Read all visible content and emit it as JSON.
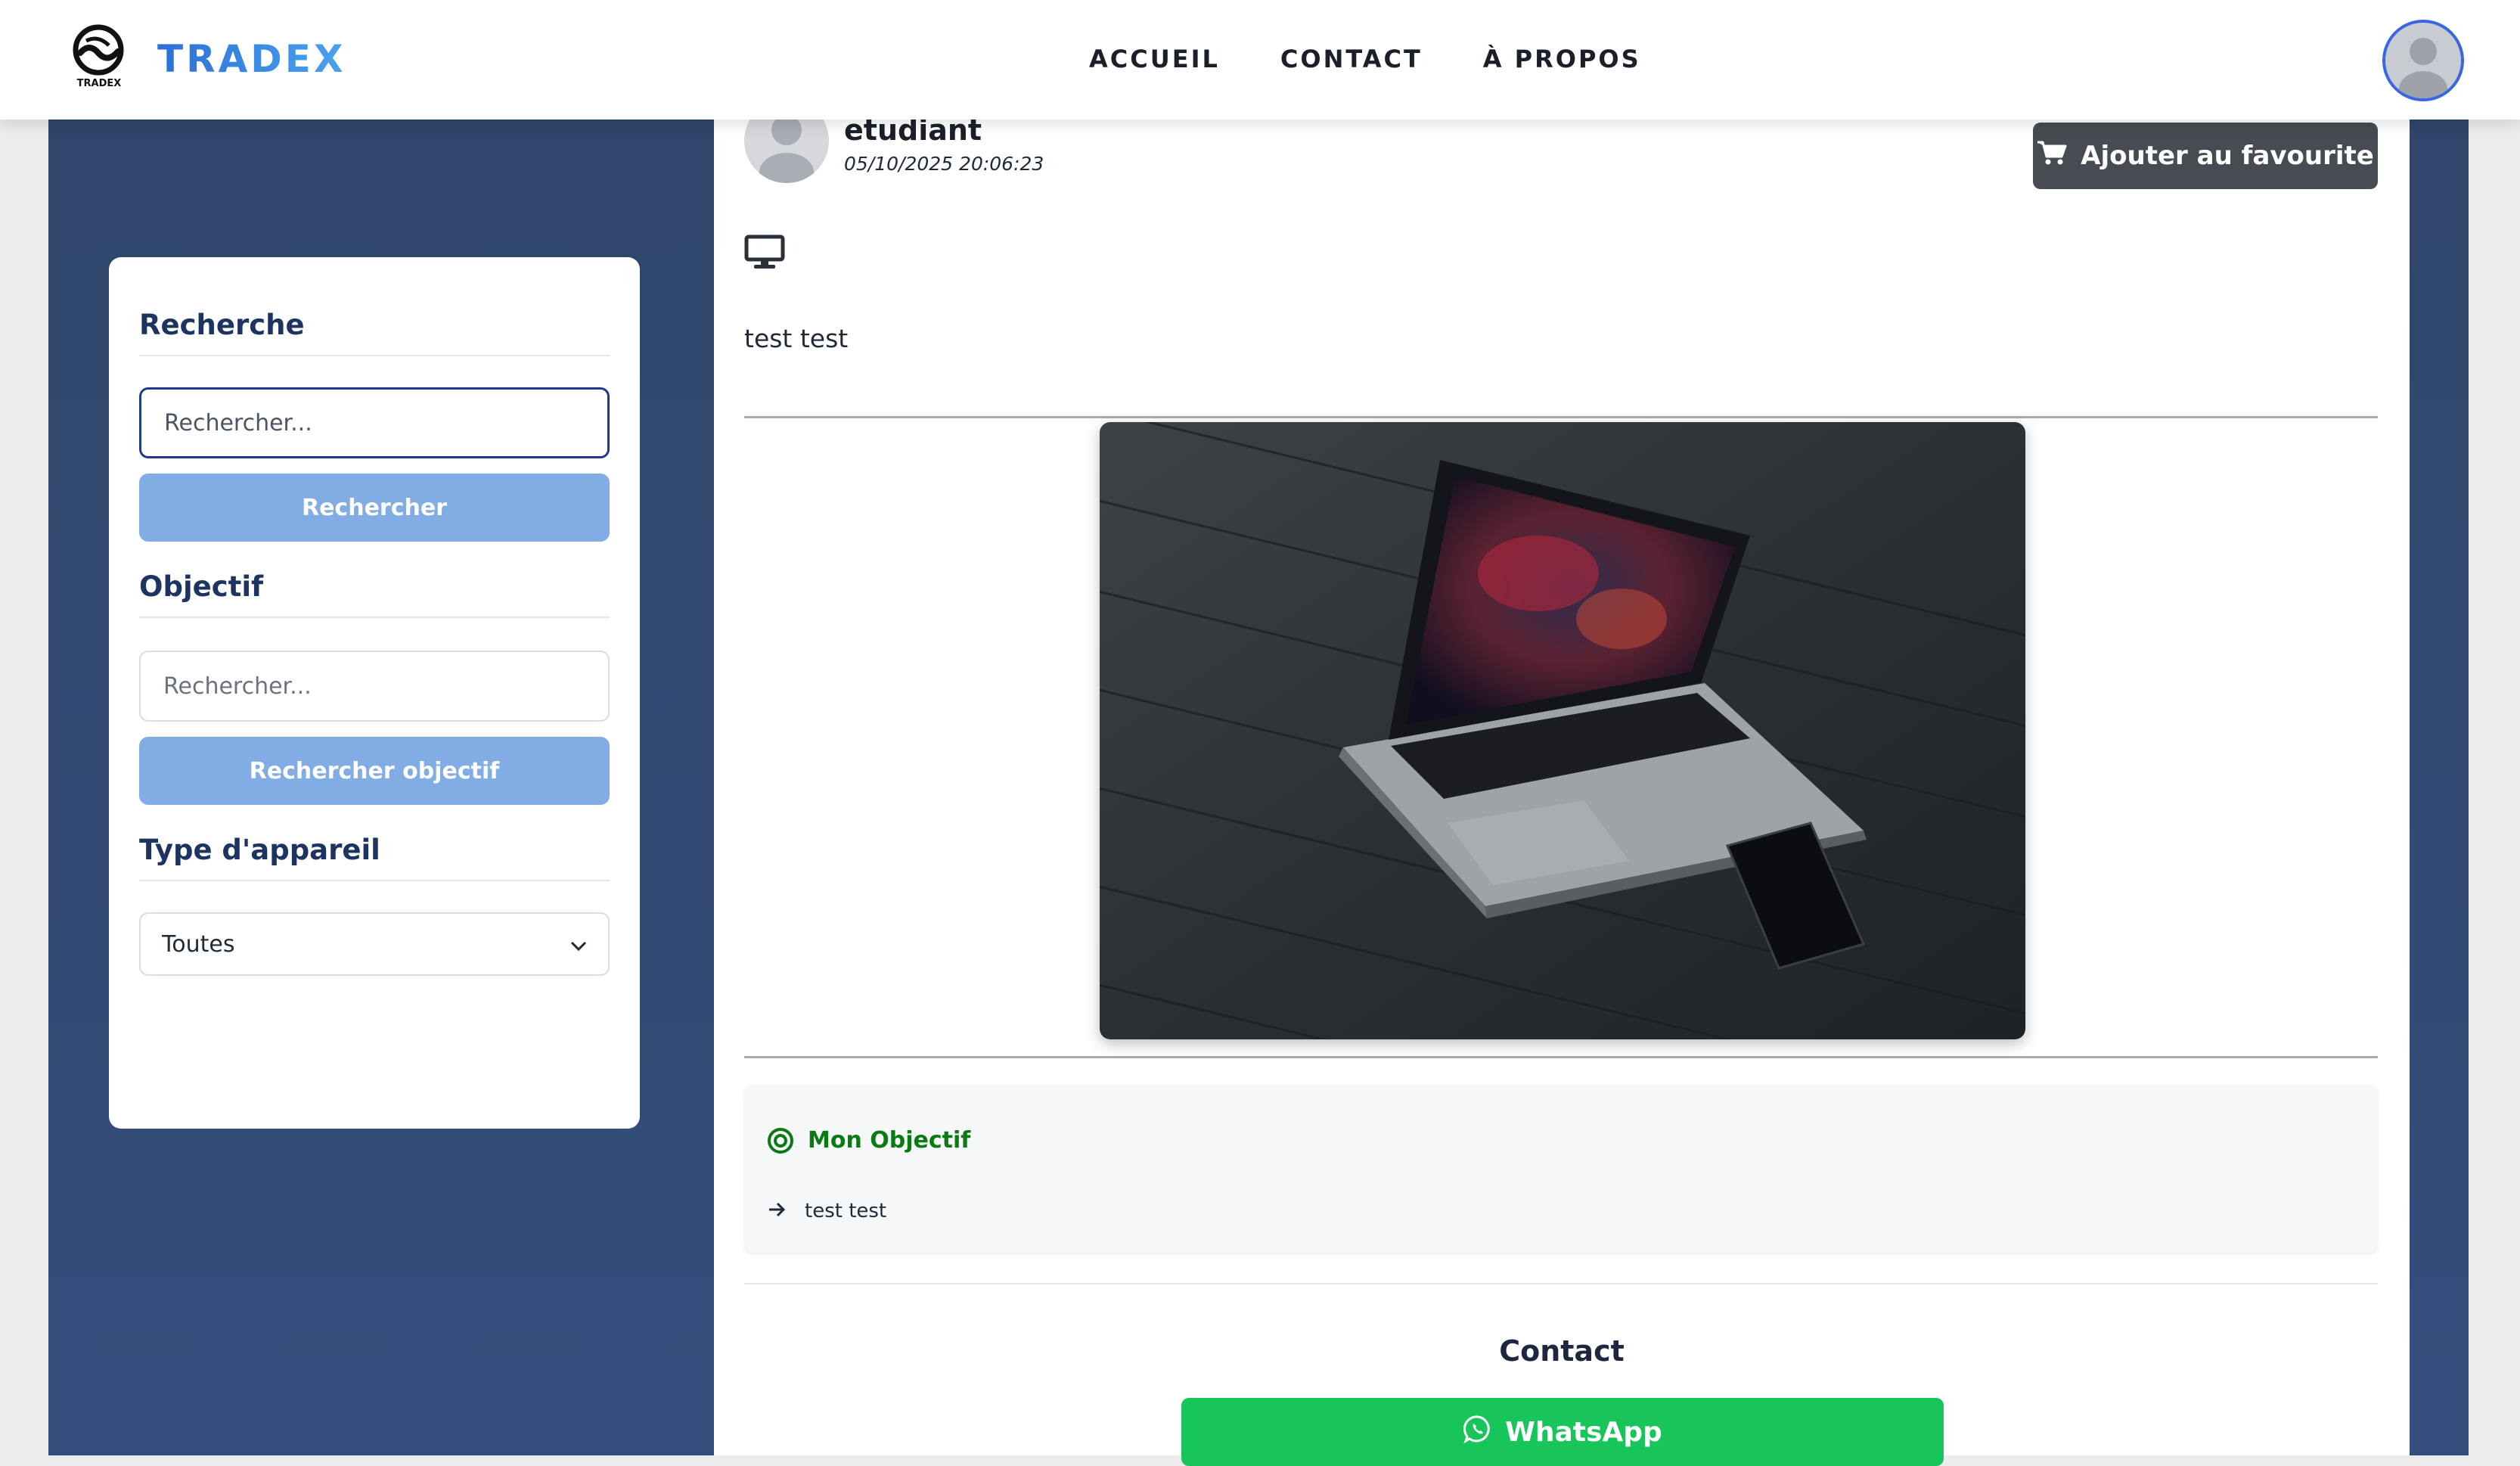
{
  "brand": {
    "name": "TRADEX",
    "logo_caption": "TRADEX"
  },
  "nav": {
    "items": [
      "ACCUEIL",
      "CONTACT",
      "À PROPOS"
    ]
  },
  "sidebar": {
    "search": {
      "title": "Recherche",
      "placeholder": "Rechercher...",
      "button": "Rechercher"
    },
    "objective": {
      "title": "Objectif",
      "placeholder": "Rechercher...",
      "button": "Rechercher objectif"
    },
    "device_type": {
      "title": "Type d'appareil",
      "selected": "Toutes"
    }
  },
  "post": {
    "author": "etudiant",
    "date": "05/10/2025 20:06:23",
    "favorite_button": "Ajouter au favourite",
    "device_icon": "desktop-icon",
    "description": "test test",
    "objective": {
      "title": "Mon Objectif",
      "items": [
        "test test"
      ]
    },
    "contact": {
      "title": "Contact",
      "whatsapp_label": "WhatsApp"
    }
  },
  "colors": {
    "backdrop": "#344e7c",
    "brand_gradient": [
      "#2c6fd6",
      "#4aa3f0"
    ],
    "sidebar_heading": "#1d3461",
    "primary_button": "#82ace4",
    "favorite_button": "#474c52",
    "objective_green": "#0b7a12",
    "whatsapp_green": "#17c55a"
  }
}
